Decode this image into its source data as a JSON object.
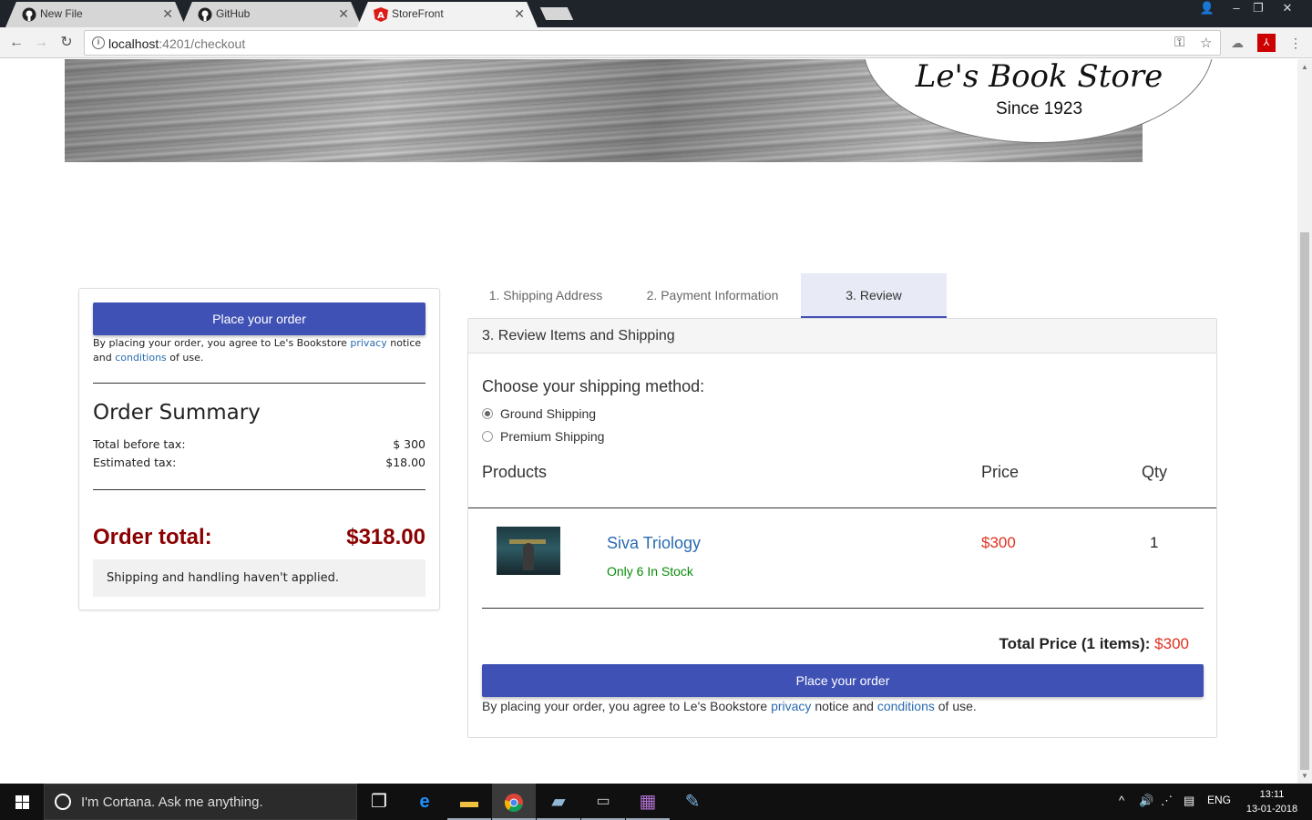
{
  "browser": {
    "tabs": [
      {
        "label": "New File",
        "icon": "github-icon"
      },
      {
        "label": "GitHub",
        "icon": "github-icon"
      },
      {
        "label": "StoreFront",
        "icon": "angular-icon"
      }
    ],
    "url_host": "localhost",
    "url_path": ":4201/checkout"
  },
  "banner": {
    "store_name": "Le's Book Store",
    "since": "Since 1923"
  },
  "summary": {
    "place_order_label": "Place your order",
    "agree_prefix": "By placing your order, you agree to Le's Bookstore ",
    "privacy": "privacy",
    "agree_mid": " notice and ",
    "conditions": "conditions",
    "agree_suffix": " of use.",
    "title": "Order Summary",
    "before_tax_label": "Total before tax:",
    "before_tax_value": "$ 300",
    "tax_label": "Estimated tax:",
    "tax_value": "$18.00",
    "total_label": "Order total:",
    "total_value": "$318.00",
    "note": "Shipping and handling haven't applied."
  },
  "checkout": {
    "steps": [
      "1. Shipping Address",
      "2. Payment Information",
      "3. Review"
    ],
    "active_step": 2,
    "panel_title": "3. Review Items and Shipping",
    "shipping_title": "Choose your shipping method:",
    "shipping_options": [
      "Ground Shipping",
      "Premium Shipping"
    ],
    "selected_shipping": "Ground Shipping",
    "col_products": "Products",
    "col_price": "Price",
    "col_qty": "Qty",
    "items": [
      {
        "name": "Siva Triology",
        "stock": "Only 6 In Stock",
        "price": "$300",
        "qty": "1"
      }
    ],
    "total_label": "Total Price (1 items): ",
    "total_value": "$300",
    "place_order_label": "Place your order",
    "agree_prefix": "By placing your order, you agree to Le's Bookstore ",
    "privacy": "privacy",
    "agree_mid": " notice and ",
    "conditions": "conditions",
    "agree_suffix": " of use."
  },
  "taskbar": {
    "cortana_placeholder": "I'm Cortana. Ask me anything.",
    "language": "ENG",
    "time": "13:11",
    "date": "13-01-2018"
  },
  "colors": {
    "primary": "#3f51b5",
    "total_red": "#8b0000",
    "price_red": "#e0301e",
    "stock_green": "#0a8a0a",
    "link": "#2a6bb0"
  }
}
